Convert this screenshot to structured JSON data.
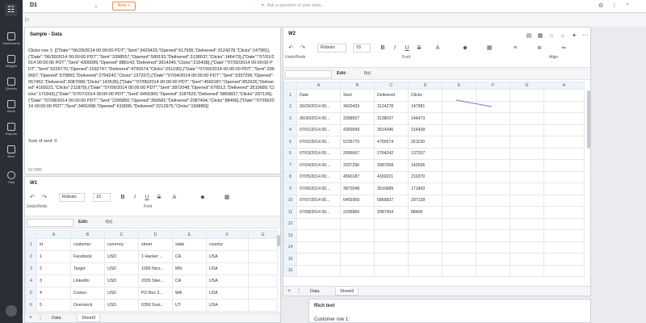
{
  "nav": {
    "items": [
      {
        "label": "Dashboards"
      },
      {
        "label": "Widgets"
      },
      {
        "label": "Queries"
      },
      {
        "label": "Alerts"
      },
      {
        "label": "Reports"
      },
      {
        "label": "More"
      },
      {
        "label": "Help"
      }
    ]
  },
  "topbar": {
    "title": "D1",
    "new_button": "New +",
    "ask_placeholder": "Ask a question of your data..."
  },
  "sample_panel": {
    "title": "Sample - Data",
    "body": "Clicks row 1: [{\"Date\":\"06/29/2014 00:00:00 PDT\",\"Sent\":3420433,\"Opened\":617995,\"Delivered\":3124278,\"Clicks\":147981},{\"Date\":\"06/30/2014 00:00:00 PDT\",\"Sent\":3398557,\"Opened\":589193,\"Delivered\":3138037,\"Clicks\":146473},{\"Date\":\"07/01/2014 00:00:00 PDT\",\"Sent\":4300099,\"Opened\":886143,\"Delivered\":3914346,\"Clicks\":216438},{\"Date\":\"07/02/2014 00:00:00 PDT\",\"Sent\":5226770,\"Opened\":1032747,\"Delivered\":4755574,\"Clicks\":251190},{\"Date\":\"07/03/2014 00:00:00 PDT\",\"Sent\":2995667,\"Opened\":579893,\"Delivered\":2764242,\"Clicks\":137207},{\"Date\":\"07/04/2014 00:00:00 PDT\",\"Sent\":3337296,\"Opened\":557452,\"Delivered\":3087068,\"Clicks\":143536},{\"Date\":\"07/05/2014 00:00:00 PDT\",\"Sent\":4560187,\"Opened\":852626,\"Delivered\":4169221,\"Clicks\":211879},{\"Date\":\"07/06/2014 00:00:00 PDT\",\"Sent\":3872048,\"Opened\":676512,\"Delivered\":3510689,\"Clicks\":171843},{\"Date\":\"07/07/2014 00:00:00 PDT\",\"Sent\":6459369,\"Opened\":1187626,\"Delivered\":5869837,\"Clicks\":297139},{\"Date\":\"07/08/2014 00:00:00 PDT\",\"Sent\":2295850,\"Opened\":350682,\"Delivered\":2087404,\"Clicks\":88406},{\"Date\":\"07/09/2014 00:00:00 PDT\",\"Sent\":3491998,\"Opened\":619095,\"Delivered\":3212975,\"Clicks\":156880}]",
    "sum_line": "Sum of sent: 0",
    "footer": "617995"
  },
  "toolbar": {
    "font": "Roboto",
    "size": "15",
    "bold": "B",
    "italic": "I",
    "underline": "U",
    "strike": "S",
    "group_undo": "Undo/Redo",
    "group_font": "Font",
    "group_align": "Align",
    "edit_label": "Edit:",
    "fx_label": "f(x)"
  },
  "w1": {
    "title": "W1",
    "col_letters": [
      "",
      "A",
      "B",
      "C",
      "D",
      "E",
      "F",
      "G"
    ],
    "rows": [
      {
        "n": "1",
        "cells": [
          "id",
          "customer",
          "currency",
          "street",
          "state",
          "country",
          ""
        ]
      },
      {
        "n": "2",
        "cells": [
          "1",
          "Facebook",
          "USD",
          "1 Hacker ...",
          "CA",
          "USA",
          ""
        ]
      },
      {
        "n": "3",
        "cells": [
          "2",
          "Target",
          "USD",
          "1000 Nico...",
          "MN",
          "USA",
          ""
        ]
      },
      {
        "n": "4",
        "cells": [
          "3",
          "LinkedIn",
          "USD",
          "2029 Stier...",
          "CA",
          "USA",
          ""
        ]
      },
      {
        "n": "5",
        "cells": [
          "4",
          "Costco",
          "USD",
          "PO Box 3...",
          "WA",
          "USA",
          ""
        ]
      },
      {
        "n": "6",
        "cells": [
          "5",
          "Overstock",
          "USD",
          "6350 Sout...",
          "UT",
          "USA",
          ""
        ]
      }
    ],
    "tabs": [
      "Data",
      "Sheet2"
    ]
  },
  "w2": {
    "title": "W2",
    "col_letters": [
      "",
      "A",
      "B",
      "C",
      "D",
      "E",
      "F",
      "G",
      "H"
    ],
    "rows": [
      {
        "n": "1",
        "cells": [
          "Date",
          "Sent",
          "Delivered",
          "Clicks",
          "",
          "",
          "",
          ""
        ]
      },
      {
        "n": "2",
        "cells": [
          "06/29/2014 00...",
          "3420433",
          "3124278",
          "147981",
          "",
          "",
          "",
          ""
        ]
      },
      {
        "n": "3",
        "cells": [
          "06/30/2014 00...",
          "3398557",
          "3138037",
          "146473",
          "",
          "",
          "",
          ""
        ]
      },
      {
        "n": "4",
        "cells": [
          "07/01/2014 00...",
          "4300099",
          "3914346",
          "216438",
          "",
          "",
          "",
          ""
        ]
      },
      {
        "n": "5",
        "cells": [
          "07/02/2014 00...",
          "5226770",
          "4755574",
          "251190",
          "",
          "",
          "",
          ""
        ]
      },
      {
        "n": "6",
        "cells": [
          "07/03/2014 00...",
          "2995667",
          "2764242",
          "137207",
          "",
          "",
          "",
          ""
        ]
      },
      {
        "n": "7",
        "cells": [
          "07/04/2014 00...",
          "3337296",
          "3087068",
          "143536",
          "",
          "",
          "",
          ""
        ]
      },
      {
        "n": "8",
        "cells": [
          "07/05/2014 00...",
          "4560187",
          "4169221",
          "211879",
          "",
          "",
          "",
          ""
        ]
      },
      {
        "n": "9",
        "cells": [
          "07/06/2014 00...",
          "3872048",
          "3510689",
          "171843",
          "",
          "",
          "",
          ""
        ]
      },
      {
        "n": "10",
        "cells": [
          "07/07/2014 00...",
          "6459369",
          "5869837",
          "297139",
          "",
          "",
          "",
          ""
        ]
      },
      {
        "n": "11",
        "cells": [
          "07/08/2014 00...",
          "2295850",
          "2087404",
          "88406",
          "",
          "",
          "",
          ""
        ]
      },
      {
        "n": "12",
        "cells": [
          "",
          "",
          "",
          "",
          "",
          "",
          "",
          ""
        ]
      },
      {
        "n": "13",
        "cells": [
          "",
          "",
          "",
          "",
          "",
          "",
          "",
          ""
        ]
      },
      {
        "n": "14",
        "cells": [
          "",
          "",
          "",
          "",
          "",
          "",
          "",
          ""
        ]
      },
      {
        "n": "15",
        "cells": [
          "",
          "",
          "",
          "",
          "",
          "",
          "",
          ""
        ]
      },
      {
        "n": "16",
        "cells": [
          "",
          "",
          "",
          "",
          "",
          "",
          "",
          ""
        ]
      },
      {
        "n": "17",
        "cells": [
          "",
          "",
          "",
          "",
          "",
          "",
          "",
          ""
        ]
      },
      {
        "n": "18",
        "cells": [
          "",
          "",
          "",
          "",
          "",
          "",
          "",
          ""
        ]
      }
    ],
    "tabs": [
      "Data",
      "Sheet2"
    ]
  },
  "rich_text": {
    "title": "Rich text",
    "line": "Customer row 1:"
  }
}
